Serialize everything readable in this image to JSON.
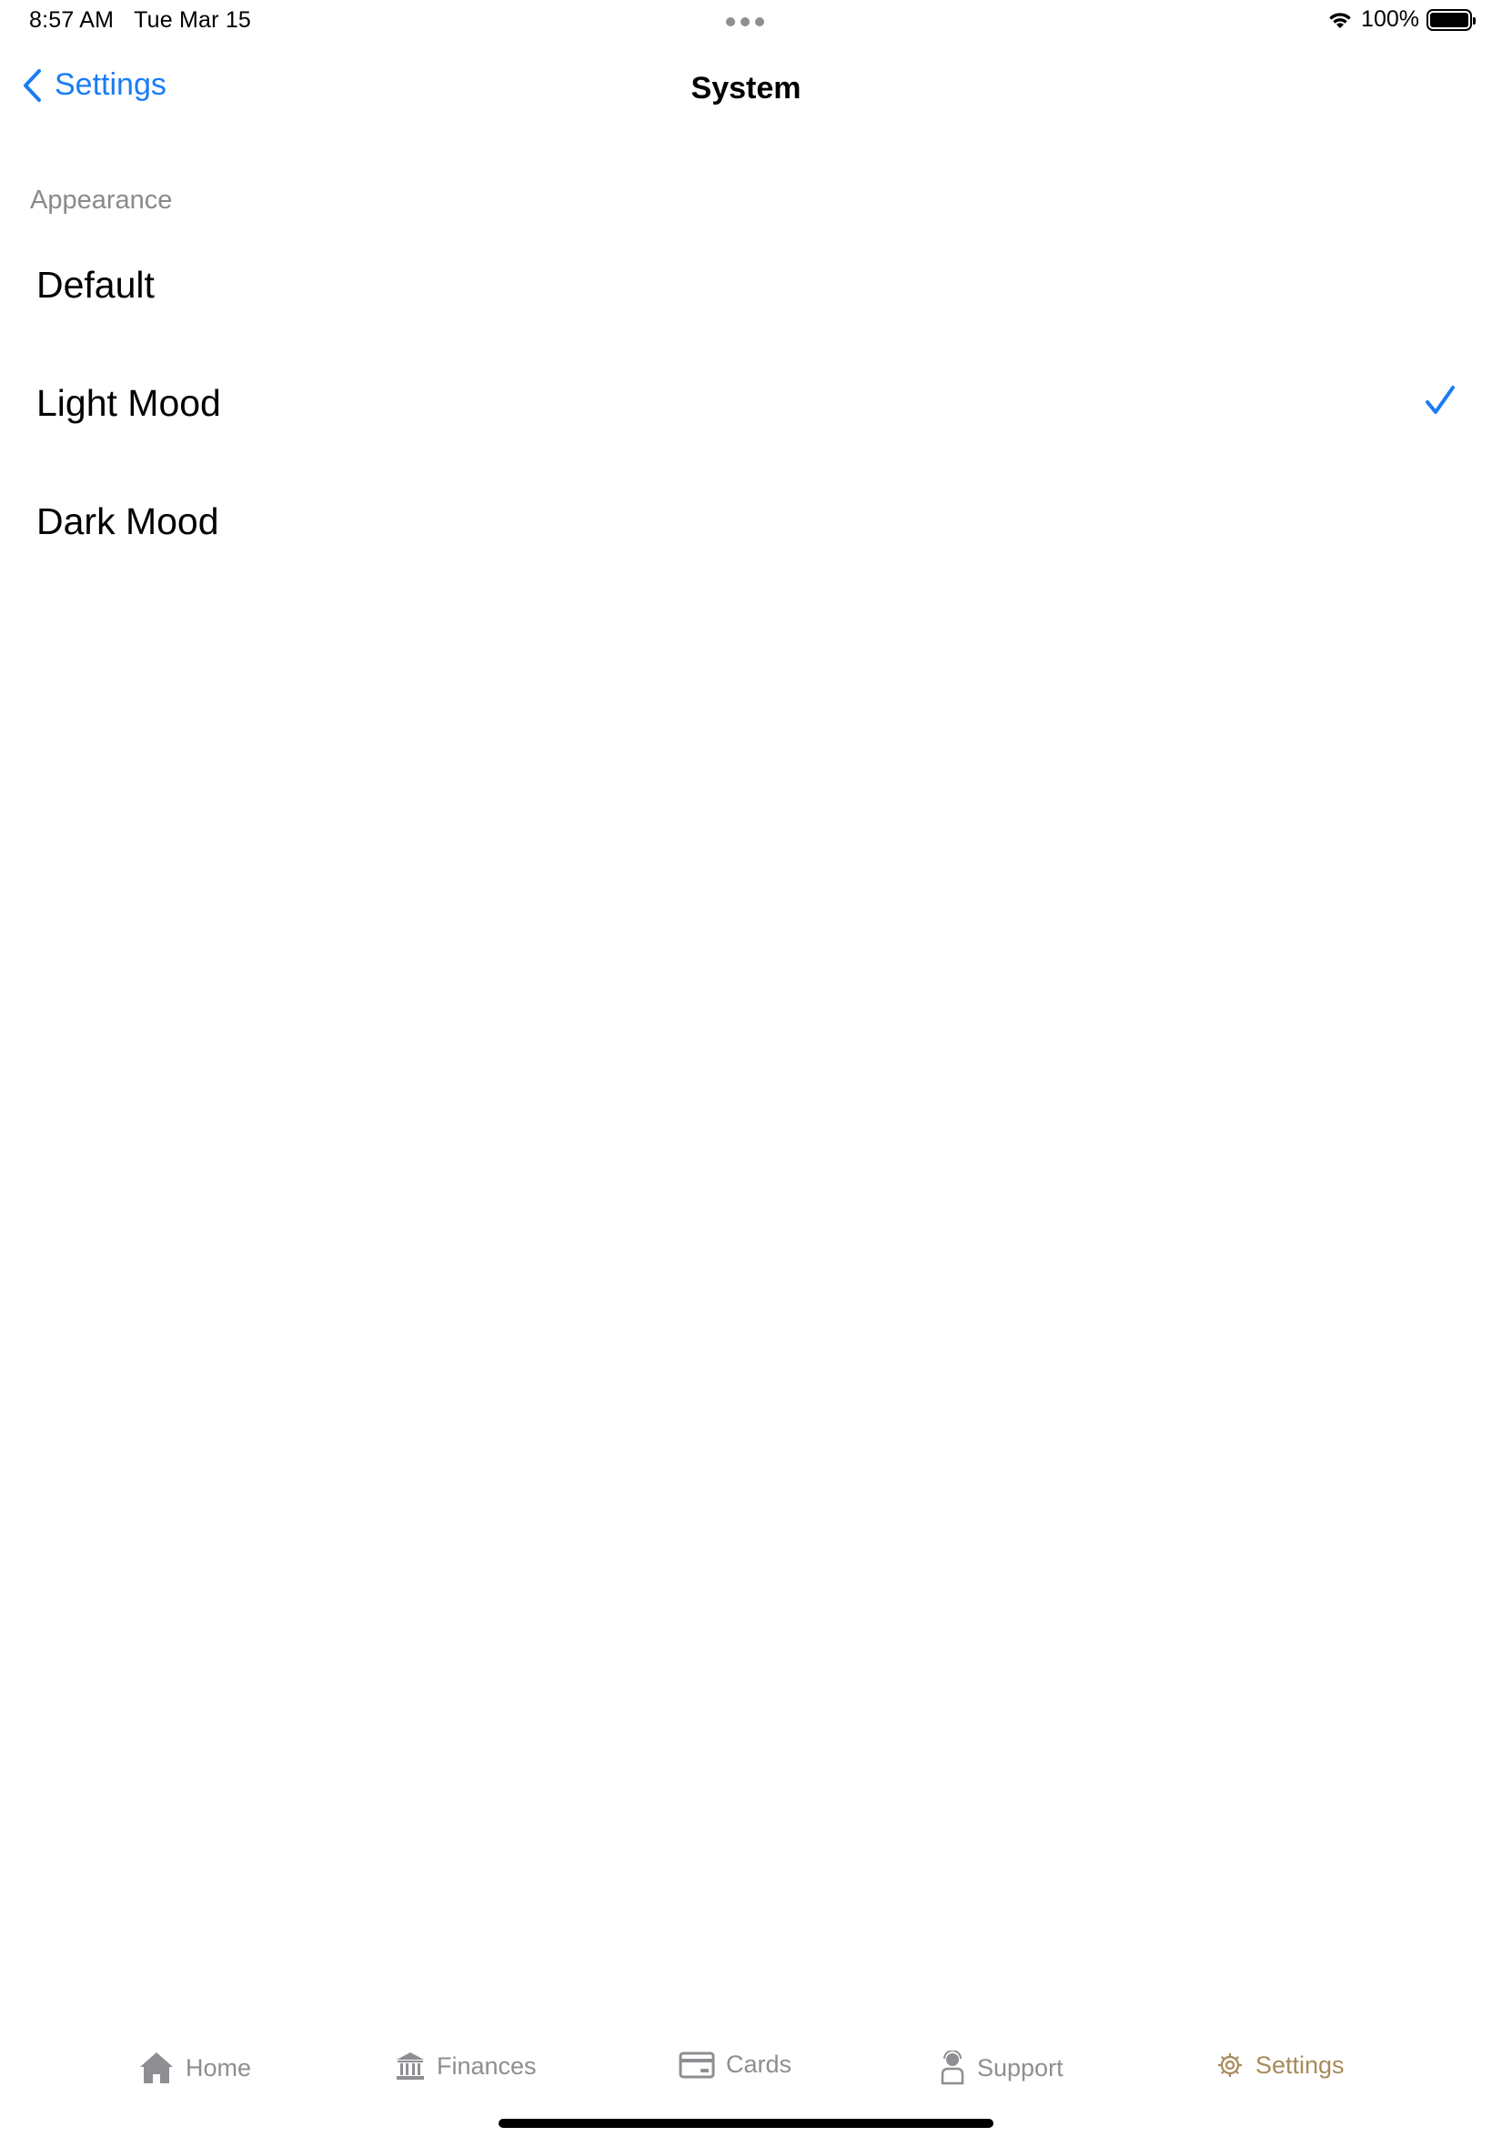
{
  "status_bar": {
    "time": "8:57 AM",
    "date": "Tue Mar 15",
    "battery": "100%",
    "battery_level": 1.0
  },
  "nav": {
    "back_label": "Settings",
    "title": "System"
  },
  "appearance": {
    "section_title": "Appearance",
    "options": [
      {
        "label": "Default",
        "selected": false
      },
      {
        "label": "Light Mood",
        "selected": true
      },
      {
        "label": "Dark Mood",
        "selected": false
      }
    ]
  },
  "tab_bar": {
    "items": [
      {
        "label": "Home",
        "icon": "house-icon",
        "active": false
      },
      {
        "label": "Finances",
        "icon": "bank-icon",
        "active": false
      },
      {
        "label": "Cards",
        "icon": "credit-card-icon",
        "active": false
      },
      {
        "label": "Support",
        "icon": "support-agent-icon",
        "active": false
      },
      {
        "label": "Settings",
        "icon": "gear-icon",
        "active": true
      }
    ]
  },
  "colors": {
    "accent": "#1a7cf5",
    "tab_active": "#a88a59",
    "tab_inactive": "#8e8e93",
    "section_header": "#8a8a8e"
  }
}
